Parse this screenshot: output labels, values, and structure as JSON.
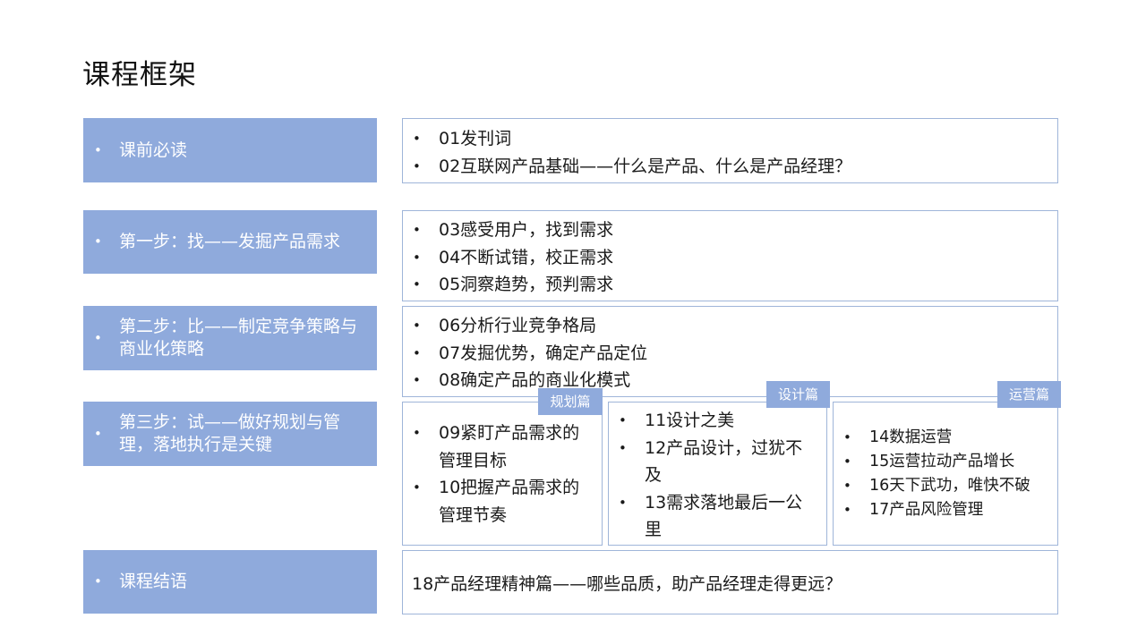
{
  "title": "课程框架",
  "sections": [
    {
      "label": "课前必读"
    },
    {
      "label": "第一步：找——发掘产品需求"
    },
    {
      "label": "第二步：比——制定竞争策略与商业化策略"
    },
    {
      "label": "第三步：试——做好规划与管理，落地执行是关键"
    },
    {
      "label": "课程结语"
    }
  ],
  "details": {
    "prep": [
      "01发刊词",
      "02互联网产品基础——什么是产品、什么是产品经理？"
    ],
    "step1": [
      "03感受用户，找到需求",
      "04不断试错，校正需求",
      "05洞察趋势，预判需求"
    ],
    "step2": [
      "06分析行业竞争格局",
      "07发掘优势，确定产品定位",
      "08确定产品的商业化模式"
    ],
    "step3": {
      "planning": {
        "tag": "规划篇",
        "items": [
          "09紧盯产品需求的管理目标",
          "10把握产品需求的管理节奏"
        ]
      },
      "design": {
        "tag": "设计篇",
        "items": [
          "11设计之美",
          "12产品设计，过犹不及",
          "13需求落地最后一公里"
        ]
      },
      "operation": {
        "tag": "运营篇",
        "items": [
          "14数据运营",
          "15运营拉动产品增长",
          "16天下武功，唯快不破",
          "17产品风险管理"
        ]
      }
    },
    "closing": "18产品经理精神篇——哪些品质，助产品经理走得更远？"
  },
  "colors": {
    "accent": "#8faadc",
    "border": "#9fb5d9"
  }
}
